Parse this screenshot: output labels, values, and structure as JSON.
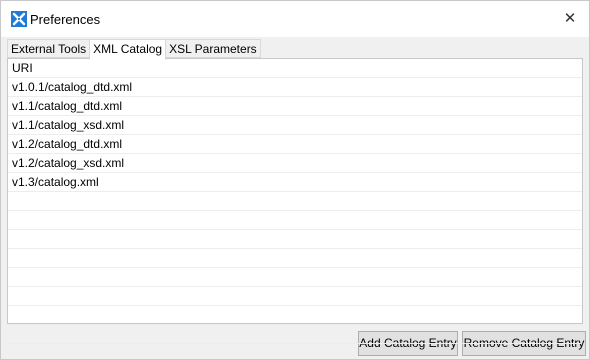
{
  "window": {
    "title": "Preferences",
    "close_glyph": "✕"
  },
  "tabs": [
    {
      "label": "External Tools",
      "active": false
    },
    {
      "label": "XML Catalog",
      "active": true
    },
    {
      "label": "XSL Parameters",
      "active": false
    }
  ],
  "catalog": {
    "header": "URI",
    "entries": [
      "v1.0.1/catalog_dtd.xml",
      "v1.1/catalog_dtd.xml",
      "v1.1/catalog_xsd.xml",
      "v1.2/catalog_dtd.xml",
      "v1.2/catalog_xsd.xml",
      "v1.3/catalog.xml"
    ]
  },
  "buttons": {
    "add": "Add Catalog Entry",
    "remove": "Remove Catalog Entry"
  },
  "colors": {
    "app_icon": "#1e7bd6",
    "window_bg": "#f0f0f0",
    "panel_bg": "#ffffff"
  }
}
